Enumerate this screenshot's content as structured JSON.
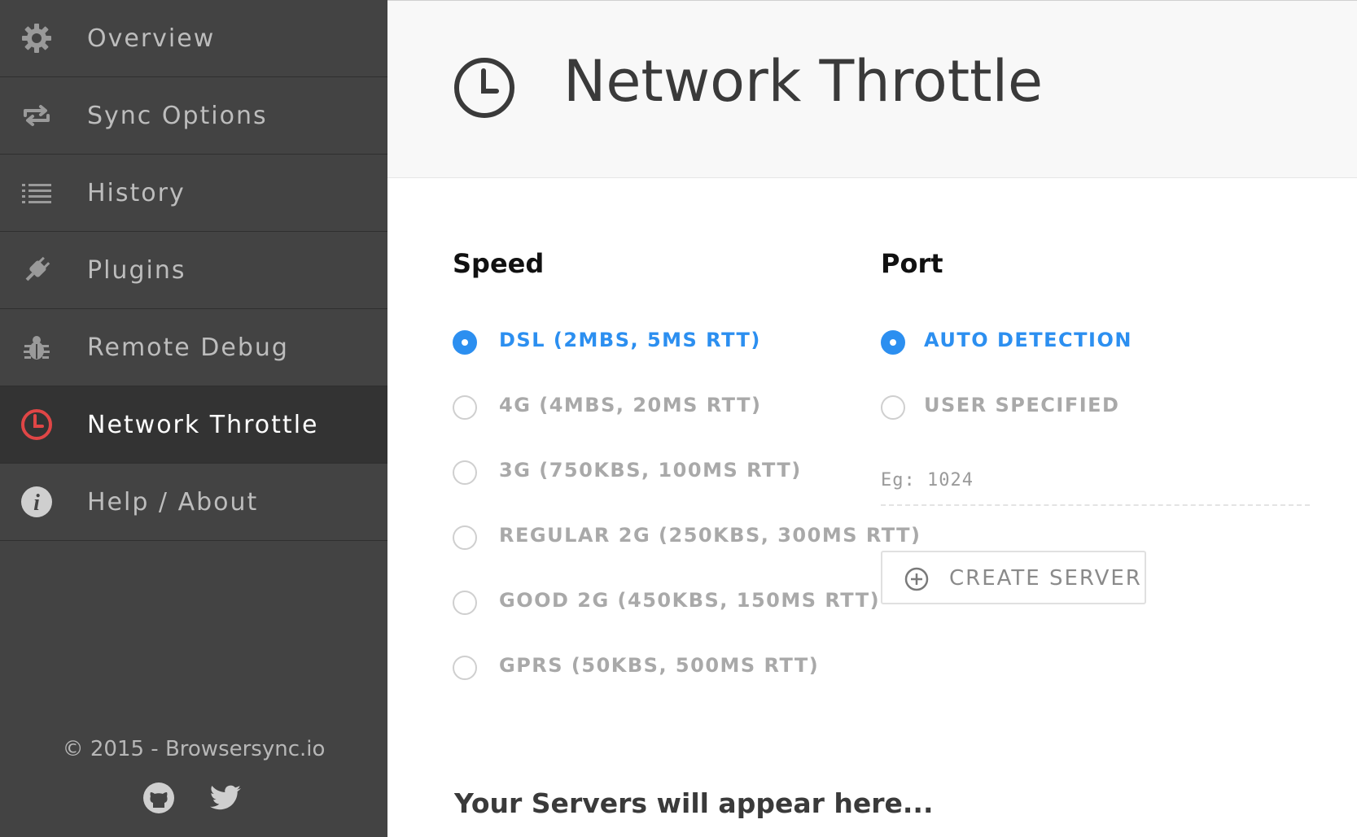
{
  "sidebar": {
    "items": [
      {
        "label": "Overview",
        "icon": "gear-icon"
      },
      {
        "label": "Sync Options",
        "icon": "sync-icon"
      },
      {
        "label": "History",
        "icon": "list-icon"
      },
      {
        "label": "Plugins",
        "icon": "plug-icon"
      },
      {
        "label": "Remote Debug",
        "icon": "bug-icon"
      },
      {
        "label": "Network Throttle",
        "icon": "clock-icon",
        "active": true
      },
      {
        "label": "Help / About",
        "icon": "info-icon"
      }
    ],
    "footer": "© 2015 - Browsersync.io",
    "social": [
      "github-icon",
      "twitter-icon"
    ]
  },
  "header": {
    "title": "Network Throttle",
    "icon": "clock-icon"
  },
  "speed": {
    "title": "Speed",
    "options": [
      {
        "label": "DSL (2MBS, 5MS RTT)",
        "selected": true
      },
      {
        "label": "4G (4MBS, 20MS RTT)",
        "selected": false
      },
      {
        "label": "3G (750KBS, 100MS RTT)",
        "selected": false
      },
      {
        "label": "REGULAR 2G (250KBS, 300MS RTT)",
        "selected": false
      },
      {
        "label": "GOOD 2G (450KBS, 150MS RTT)",
        "selected": false
      },
      {
        "label": "GPRS (50KBS, 500MS RTT)",
        "selected": false
      }
    ]
  },
  "port": {
    "title": "Port",
    "options": [
      {
        "label": "AUTO DETECTION",
        "selected": true
      },
      {
        "label": "USER SPECIFIED",
        "selected": false
      }
    ],
    "input_placeholder": "Eg: 1024",
    "input_value": "",
    "create_label": "CREATE SERVER"
  },
  "servers_text": "Your Servers will appear here...",
  "colors": {
    "accent": "#2c8ff0",
    "active_icon": "#e04646",
    "sidebar_bg": "#434343",
    "active_bg": "#333333"
  }
}
